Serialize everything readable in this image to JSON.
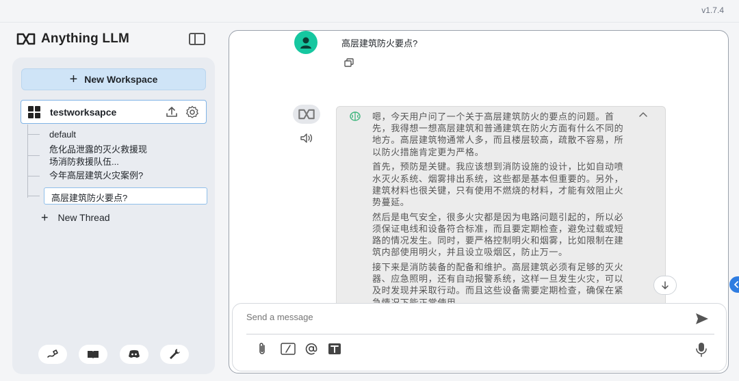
{
  "app": {
    "version": "v1.7.4",
    "brand": "Anything LLM"
  },
  "sidebar": {
    "new_workspace_label": "New Workspace",
    "workspace": {
      "name": "testworksapce"
    },
    "threads": [
      {
        "label": "default"
      },
      {
        "label": "危化品泄露的灭火救援现场消防救援队伍..."
      },
      {
        "label": "今年高层建筑火灾案例?"
      },
      {
        "label": "高层建筑防火要点?"
      }
    ],
    "thread_lines": [
      "危化品泄露的灭火救援现",
      "场消防救援队伍..."
    ],
    "new_thread_label": "New Thread",
    "footer_icons": [
      "community-hub-icon",
      "docs-book-icon",
      "discord-icon",
      "settings-wrench-icon"
    ]
  },
  "chat": {
    "user_message": "高层建筑防火要点?",
    "thinking_paragraphs": [
      "嗯，今天用户问了一个关于高层建筑防火的要点的问题。首先，我得想一想高层建筑和普通建筑在防火方面有什么不同的地方。高层建筑物通常人多，而且楼层较高，疏散不容易，所以防火措施肯定更为严格。",
      "首先，预防是关键。我应该想到消防设施的设计，比如自动喷水灭火系统、烟雾排出系统，这些都是基本但重要的。另外，建筑材料也很关键，只有使用不燃烧的材料，才能有效阻止火势蔓延。",
      "然后是电气安全，很多火灾都是因为电路问题引起的，所以必须保证电线和设备符合标准，而且要定期检查，避免过载或短路的情况发生。同时，要严格控制明火和烟雾，比如限制在建筑内部使用明火，并且设立吸烟区，防止万一。",
      "接下来是消防装备的配备和维护。高层建筑必须有足够的灭火器、应急照明，还有自动报警系统，这样一旦发生火灾，可以及时发现并采取行动。而且这些设备需要定期检查，确保在紧急情况下能正常使用。"
    ]
  },
  "composer": {
    "placeholder": "Send a message"
  },
  "colors": {
    "accent": "#2f7de1",
    "new_workspace_bg": "#cfe4f7",
    "user_avatar": "#16c7a0"
  }
}
